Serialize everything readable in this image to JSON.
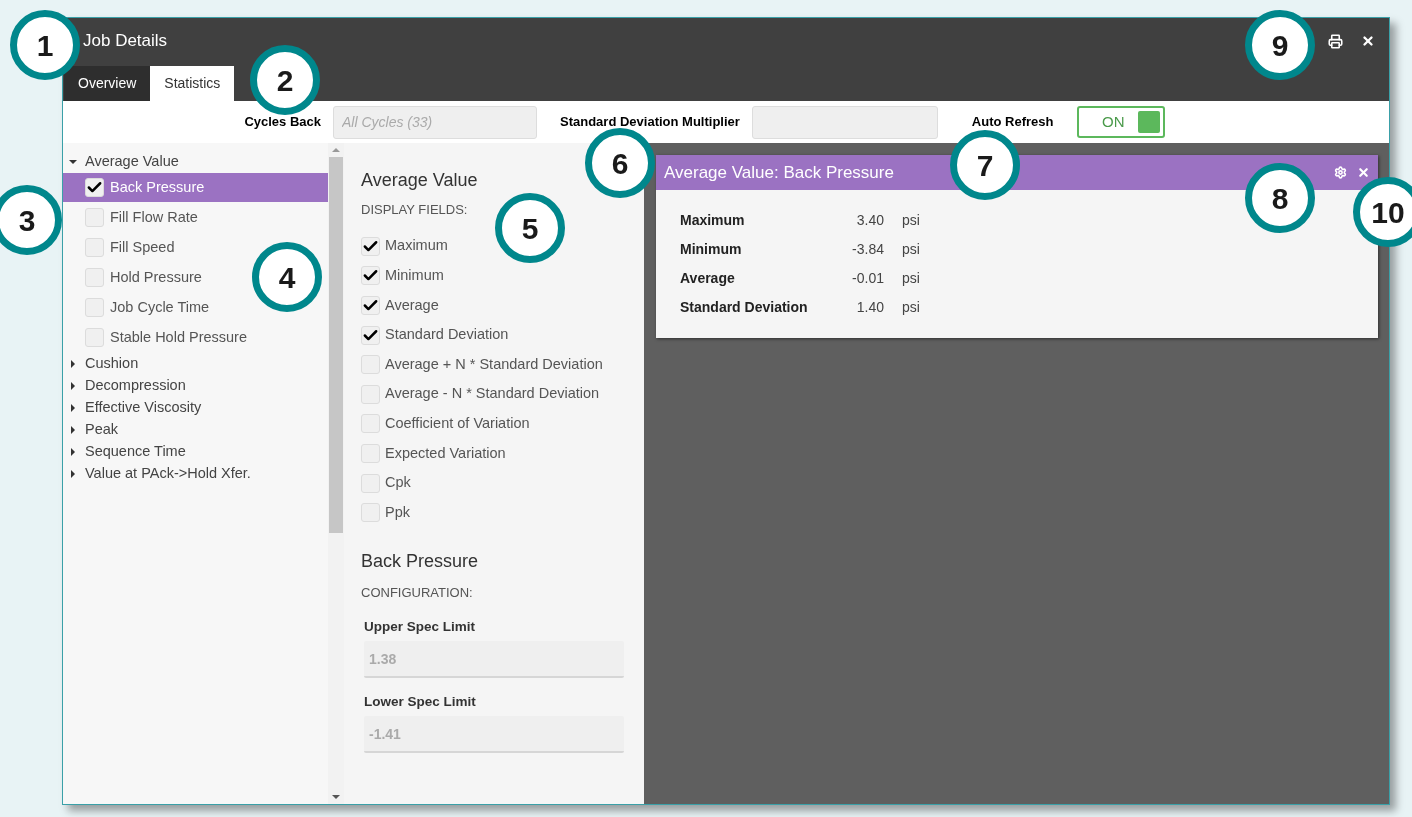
{
  "window": {
    "title": "Job Details"
  },
  "tabs": [
    {
      "label": "Overview",
      "selected": false
    },
    {
      "label": "Statistics",
      "selected": true
    }
  ],
  "toolbar": {
    "cycles_back": {
      "label": "Cycles Back",
      "placeholder": "All Cycles (33)"
    },
    "std_dev_multiplier": {
      "label": "Standard Deviation Multiplier"
    },
    "auto_refresh": {
      "label": "Auto Refresh",
      "on": true,
      "text": "ON"
    }
  },
  "tree": [
    {
      "label": "Average Value",
      "expanded": true,
      "children": [
        {
          "label": "Back Pressure",
          "checked": true,
          "selected": true
        },
        {
          "label": "Fill Flow Rate",
          "checked": false,
          "selected": false
        },
        {
          "label": "Fill Speed",
          "checked": false,
          "selected": false
        },
        {
          "label": "Hold Pressure",
          "checked": false,
          "selected": false
        },
        {
          "label": "Job Cycle Time",
          "checked": false,
          "selected": false
        },
        {
          "label": "Stable Hold Pressure",
          "checked": false,
          "selected": false
        }
      ]
    },
    {
      "label": "Cushion",
      "expanded": false
    },
    {
      "label": "Decompression",
      "expanded": false
    },
    {
      "label": "Effective Viscosity",
      "expanded": false
    },
    {
      "label": "Peak",
      "expanded": false
    },
    {
      "label": "Sequence Time",
      "expanded": false
    },
    {
      "label": "Value at PAck->Hold Xfer.",
      "expanded": false
    }
  ],
  "display": {
    "heading": "Average Value",
    "subheading": "DISPLAY FIELDS:",
    "fields": [
      {
        "label": "Maximum",
        "checked": true
      },
      {
        "label": "Minimum",
        "checked": true
      },
      {
        "label": "Average",
        "checked": true
      },
      {
        "label": "Standard Deviation",
        "checked": true
      },
      {
        "label": "Average + N * Standard Deviation",
        "checked": false
      },
      {
        "label": "Average - N * Standard Deviation",
        "checked": false
      },
      {
        "label": "Coefficient of Variation",
        "checked": false
      },
      {
        "label": "Expected Variation",
        "checked": false
      },
      {
        "label": "Cpk",
        "checked": false
      },
      {
        "label": "Ppk",
        "checked": false
      }
    ]
  },
  "configuration": {
    "heading": "Back Pressure",
    "subheading": "CONFIGURATION:",
    "limits": [
      {
        "label": "Upper Spec Limit",
        "value": "1.38"
      },
      {
        "label": "Lower Spec Limit",
        "value": "-1.41"
      }
    ]
  },
  "card": {
    "title": "Average Value: Back Pressure",
    "rows": [
      {
        "label": "Maximum",
        "value": "3.40",
        "unit": "psi"
      },
      {
        "label": "Minimum",
        "value": "-3.84",
        "unit": "psi"
      },
      {
        "label": "Average",
        "value": "-0.01",
        "unit": "psi"
      },
      {
        "label": "Standard Deviation",
        "value": "1.40",
        "unit": "psi"
      }
    ]
  },
  "callouts": [
    "1",
    "2",
    "3",
    "4",
    "5",
    "6",
    "7",
    "8",
    "9",
    "10"
  ]
}
